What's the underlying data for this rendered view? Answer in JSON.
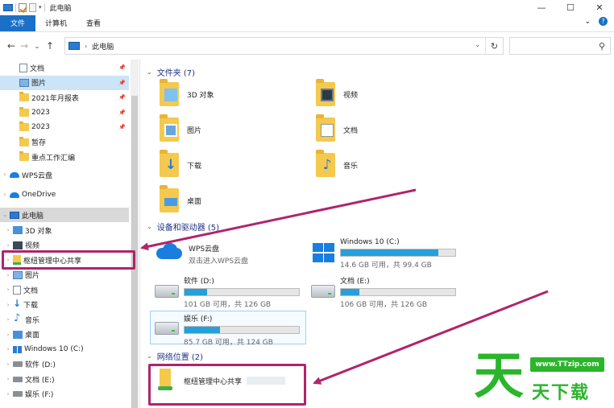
{
  "window": {
    "title": "此电脑",
    "controls": [
      "—",
      "☐",
      "✕"
    ]
  },
  "ribbon": {
    "tabs": [
      "文件",
      "计算机",
      "查看"
    ],
    "expand_glyph": "⌄",
    "help_glyph": "?"
  },
  "address": {
    "path": "此电脑",
    "search_placeholder": ""
  },
  "sidebar": {
    "quick": [
      {
        "label": "文档",
        "icon": "document-icon",
        "pinned": true
      },
      {
        "label": "图片",
        "icon": "pictures-icon",
        "pinned": true,
        "selected": true
      },
      {
        "label": "2021年月报表",
        "icon": "folder-icon",
        "pinned": true
      },
      {
        "label": "2023",
        "icon": "folder-icon",
        "pinned": true
      },
      {
        "label": "2023",
        "icon": "folder-icon",
        "pinned": true
      },
      {
        "label": "暂存",
        "icon": "folder-icon",
        "pinned": false
      },
      {
        "label": "重点工作汇编",
        "icon": "folder-icon",
        "pinned": false
      }
    ],
    "wps": "WPS云盘",
    "onedrive": "OneDrive",
    "thispc": "此电脑",
    "pc_children": [
      {
        "label": "3D 对象",
        "icon": "cube-icon"
      },
      {
        "label": "视频",
        "icon": "video-icon"
      },
      {
        "label": "枢纽管理中心共享",
        "icon": "network-share-icon"
      },
      {
        "label": "图片",
        "icon": "pictures-icon"
      },
      {
        "label": "文档",
        "icon": "document-icon"
      },
      {
        "label": "下载",
        "icon": "download-icon"
      },
      {
        "label": "音乐",
        "icon": "music-icon"
      },
      {
        "label": "桌面",
        "icon": "desktop-icon"
      },
      {
        "label": "Windows 10 (C:)",
        "icon": "windows-drive-icon"
      },
      {
        "label": "软件 (D:)",
        "icon": "drive-icon"
      },
      {
        "label": "文档 (E:)",
        "icon": "drive-icon"
      },
      {
        "label": "娱乐 (F:)",
        "icon": "drive-icon"
      }
    ]
  },
  "groups": {
    "folders": "文件夹 (7)",
    "devices": "设备和驱动器 (5)",
    "network": "网络位置 (2)"
  },
  "folders": [
    {
      "name": "3D 对象",
      "badge": "b3d"
    },
    {
      "name": "视频",
      "badge": "bfilm"
    },
    {
      "name": "图片",
      "badge": "bimg"
    },
    {
      "name": "文档",
      "badge": "bdoc"
    },
    {
      "name": "下载",
      "badge": "bdown"
    },
    {
      "name": "音乐",
      "badge": "bmusic"
    },
    {
      "name": "桌面",
      "badge": "bdesk"
    }
  ],
  "drives": {
    "wps": {
      "name": "WPS云盘",
      "sub": "双击进入WPS云盘"
    },
    "c": {
      "name": "Windows 10 (C:)",
      "free": "14.6 GB 可用，共 99.4 GB",
      "used_fraction": 0.853
    },
    "d": {
      "name": "软件 (D:)",
      "free": "101 GB 可用，共 126 GB",
      "used_fraction": 0.198
    },
    "e": {
      "name": "文档 (E:)",
      "free": "106 GB 可用，共 126 GB",
      "used_fraction": 0.159
    },
    "f": {
      "name": "娱乐 (F:)",
      "free": "85.7 GB 可用，共 124 GB",
      "used_fraction": 0.309
    }
  },
  "network_items": [
    {
      "name": "枢纽管理中心共享"
    }
  ],
  "watermark": {
    "big": "天",
    "url": "www.TTzip.com",
    "cn": "天下载"
  },
  "colors": {
    "accent": "#1a6fc6",
    "annotation": "#b0246b",
    "bar_fill": "#26a0da",
    "watermark": "#2bb52b"
  }
}
